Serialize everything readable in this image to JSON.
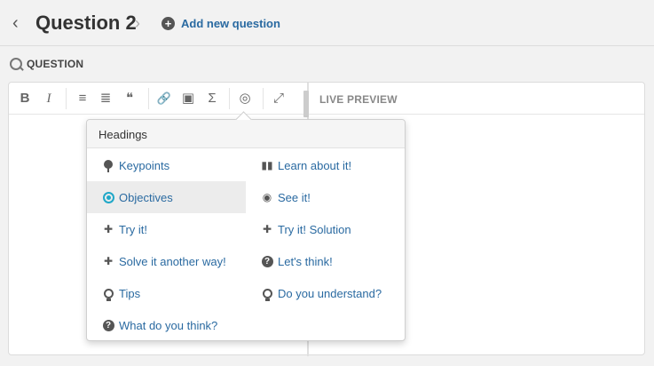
{
  "header": {
    "title": "Question 2",
    "add_label": "Add new question"
  },
  "section": {
    "label": "QUESTION"
  },
  "toolbar": {
    "bold": "B",
    "italic": "I",
    "bullets": "≡",
    "numbered": "≣",
    "quote": "❝",
    "link": "🔗",
    "image": "▣",
    "formula": "Σ",
    "headings": "◎",
    "fullscreen": "⤢"
  },
  "preview": {
    "label": "LIVE PREVIEW"
  },
  "dropdown": {
    "title": "Headings",
    "items": [
      {
        "label": "Keypoints",
        "icon": "pin-icon"
      },
      {
        "label": "Learn about it!",
        "icon": "book-icon"
      },
      {
        "label": "Objectives",
        "icon": "target-icon",
        "active": true
      },
      {
        "label": "See it!",
        "icon": "eye-icon"
      },
      {
        "label": "Try it!",
        "icon": "puzzle-icon"
      },
      {
        "label": "Try it! Solution",
        "icon": "puzzle-icon"
      },
      {
        "label": "Solve it another way!",
        "icon": "puzzle-icon"
      },
      {
        "label": "Let's think!",
        "icon": "question-circle-icon"
      },
      {
        "label": "Tips",
        "icon": "bulb-icon"
      },
      {
        "label": "Do you understand?",
        "icon": "bulb-icon"
      },
      {
        "label": "What do you think?",
        "icon": "question-circle-icon"
      }
    ]
  },
  "colors": {
    "link": "#2a6aa1",
    "accent": "#20a8c8"
  }
}
